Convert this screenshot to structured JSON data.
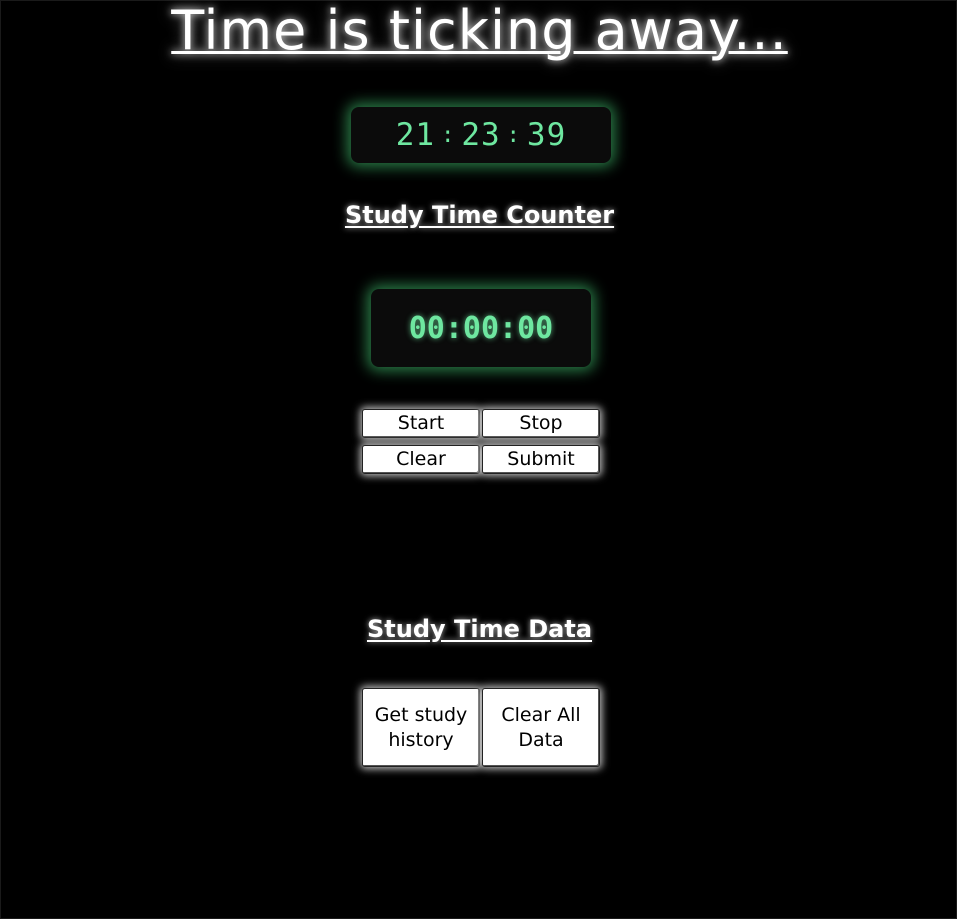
{
  "title": "Time is ticking away...",
  "clock": {
    "hours": "21",
    "minutes": "23",
    "seconds": "39",
    "separator": ":"
  },
  "counter": {
    "heading": "Study Time Counter",
    "display": "00:00:00",
    "buttons": {
      "start": "Start",
      "stop": "Stop",
      "clear": "Clear",
      "submit": "Submit"
    }
  },
  "data_section": {
    "heading": "Study Time Data",
    "buttons": {
      "history": "Get study history",
      "clear_all": "Clear All Data"
    }
  },
  "colors": {
    "background": "#000000",
    "accent_green": "#6ee7a0",
    "glow_green": "#4ade80",
    "text": "#ffffff"
  }
}
